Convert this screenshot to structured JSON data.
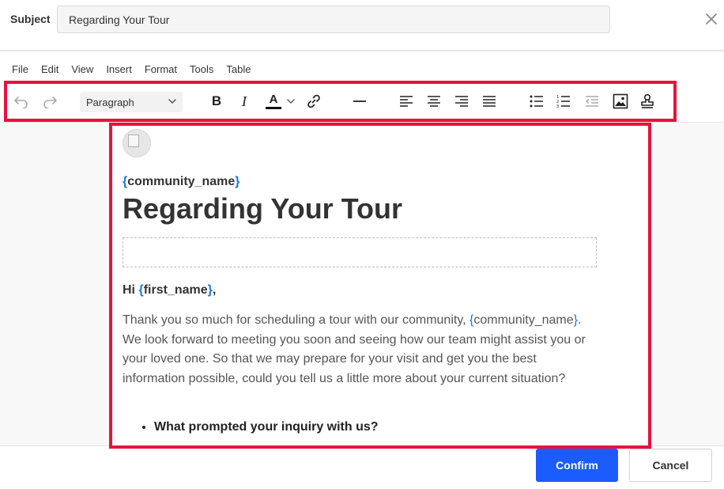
{
  "subject": {
    "label": "Subject",
    "value": "Regarding Your Tour"
  },
  "menubar": {
    "items": [
      "File",
      "Edit",
      "View",
      "Insert",
      "Format",
      "Tools",
      "Table"
    ]
  },
  "toolbar": {
    "block_format": "Paragraph",
    "bold_label": "B",
    "italic_label": "I",
    "text_color_label": "A",
    "icons": [
      "undo-icon",
      "redo-icon",
      "bold-icon",
      "italic-icon",
      "text-color-icon",
      "link-icon",
      "horizontal-line-icon",
      "align-left-icon",
      "align-center-icon",
      "align-right-icon",
      "justify-icon",
      "bullet-list-icon",
      "numbered-list-icon",
      "outdent-icon",
      "image-icon",
      "stamp-icon"
    ]
  },
  "editor": {
    "community_open": "{",
    "community_tag": "community_name",
    "community_close": "}",
    "headline": "Regarding Your Tour",
    "greeting_prefix": "Hi ",
    "greeting_open": "{",
    "greeting_tag": "first_name",
    "greeting_close": "}",
    "greeting_suffix": ",",
    "para_start": "Thank you so much for scheduling a tour with our community, ",
    "para_merge_open": "{",
    "para_merge_tag": "community_name",
    "para_merge_close": "}",
    "para_rest": ". We look forward to meeting you soon and seeing how our team might assist you or your loved one.  So that we may prepare for your visit and get you the best information possible, could you tell us a little more about your current situation?",
    "bullets": [
      "What prompted your inquiry with us?"
    ]
  },
  "footer": {
    "confirm_label": "Confirm",
    "cancel_label": "Cancel"
  },
  "colors": {
    "highlight": "#e8123d",
    "merge_tag": "#1a73e8",
    "confirm": "#1a5cff"
  }
}
